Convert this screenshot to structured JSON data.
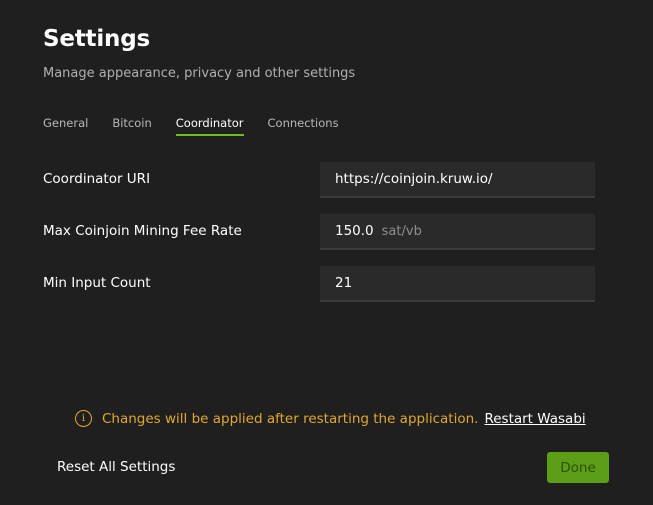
{
  "header": {
    "title": "Settings",
    "subtitle": "Manage appearance, privacy and other settings"
  },
  "tabs": [
    {
      "label": "General",
      "active": false
    },
    {
      "label": "Bitcoin",
      "active": false
    },
    {
      "label": "Coordinator",
      "active": true
    },
    {
      "label": "Connections",
      "active": false
    }
  ],
  "fields": {
    "coordinator_uri": {
      "label": "Coordinator URI",
      "value": "https://coinjoin.kruw.io/"
    },
    "max_fee_rate": {
      "label": "Max Coinjoin Mining Fee Rate",
      "value": "150.0",
      "unit": "sat/vb"
    },
    "min_input_count": {
      "label": "Min Input Count",
      "value": "21"
    }
  },
  "notice": {
    "text": "Changes will be applied after restarting the application.",
    "link_label": "Restart Wasabi",
    "icon": "info-icon"
  },
  "footer": {
    "reset_label": "Reset All Settings",
    "done_label": "Done"
  },
  "colors": {
    "background": "#1f1f1f",
    "accent": "#72bd1e",
    "warning": "#e0a832",
    "done_button": "#5c9e15"
  }
}
